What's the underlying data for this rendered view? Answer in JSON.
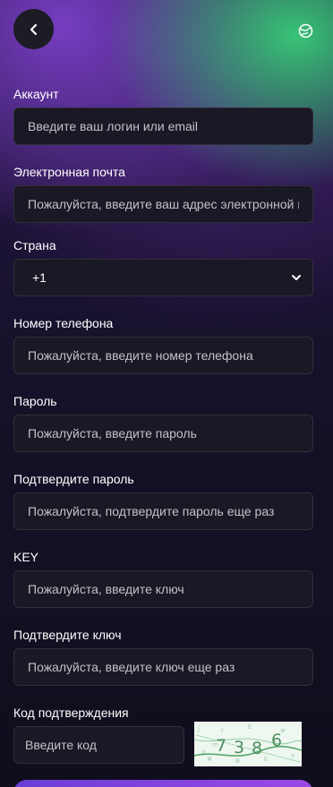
{
  "header": {
    "back_icon": "chevron-left-icon",
    "language_icon": "globe-icon"
  },
  "form": {
    "account": {
      "label": "Аккаунт",
      "placeholder": "Введите ваш логин или email"
    },
    "email": {
      "label": "Электронная почта",
      "placeholder": "Пожалуйста, введите ваш адрес электронной почты"
    },
    "country": {
      "label": "Страна",
      "value": "+1"
    },
    "phone": {
      "label": "Номер телефона",
      "placeholder": "Пожалуйста, введите номер телефона"
    },
    "password": {
      "label": "Пароль",
      "placeholder": "Пожалуйста, введите пароль"
    },
    "confirm_password": {
      "label": "Подтвердите пароль",
      "placeholder": "Пожалуйста, подтвердите пароль еще раз"
    },
    "key": {
      "label": "KEY",
      "placeholder": "Пожалуйста, введите ключ"
    },
    "confirm_key": {
      "label": "Подтвердите ключ",
      "placeholder": "Пожалуйста, введите ключ еще раз"
    },
    "verification": {
      "label": "Код подтверждения",
      "placeholder": "Введите код",
      "captcha_digits": [
        "7",
        "3",
        "8",
        "6"
      ]
    }
  },
  "colors": {
    "accent_green": "#38cd78",
    "accent_purple": "#7a40c8",
    "input_bg": "#1a1824",
    "submit_gradient_start": "#6a3fd6"
  }
}
